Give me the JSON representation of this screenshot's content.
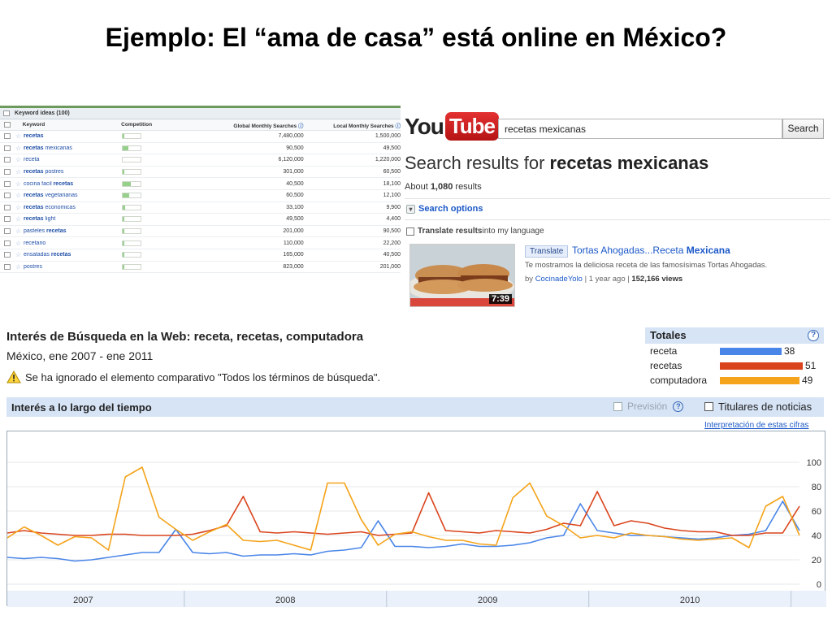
{
  "slide": {
    "title": "Ejemplo: El “ama de casa” está online en México?"
  },
  "keyword_tool": {
    "header": "Keyword ideas (100)",
    "columns": [
      "Keyword",
      "Competition",
      "Global Monthly Searches",
      "Local Monthly Searches"
    ],
    "rows": [
      {
        "pre": "",
        "bold": "recetas",
        "post": "",
        "competition": 0.1,
        "global": "7,480,000",
        "local": "1,500,000"
      },
      {
        "pre": "",
        "bold": "recetas",
        "post": " mexicanas",
        "competition": 0.3,
        "global": "90,500",
        "local": "49,500"
      },
      {
        "pre": "receta",
        "bold": "",
        "post": "",
        "competition": 0.0,
        "global": "6,120,000",
        "local": "1,220,000"
      },
      {
        "pre": "",
        "bold": "recetas",
        "post": " postres",
        "competition": 0.1,
        "global": "301,000",
        "local": "60,500"
      },
      {
        "pre": "cocina facil ",
        "bold": "recetas",
        "post": "",
        "competition": 0.45,
        "global": "40,500",
        "local": "18,100"
      },
      {
        "pre": "",
        "bold": "recetas",
        "post": " vegetarianas",
        "competition": 0.35,
        "global": "60,500",
        "local": "12,100"
      },
      {
        "pre": "",
        "bold": "recetas",
        "post": " economicas",
        "competition": 0.15,
        "global": "33,100",
        "local": "9,900"
      },
      {
        "pre": "",
        "bold": "recetas",
        "post": " light",
        "competition": 0.1,
        "global": "49,500",
        "local": "4,400"
      },
      {
        "pre": "pasteles ",
        "bold": "recetas",
        "post": "",
        "competition": 0.1,
        "global": "201,000",
        "local": "90,500"
      },
      {
        "pre": "recetario",
        "bold": "",
        "post": "",
        "competition": 0.1,
        "global": "110,000",
        "local": "22,200"
      },
      {
        "pre": "ensaladas ",
        "bold": "recetas",
        "post": "",
        "competition": 0.1,
        "global": "165,000",
        "local": "40,500"
      },
      {
        "pre": "postres",
        "bold": "",
        "post": "",
        "competition": 0.1,
        "global": "823,000",
        "local": "201,000"
      }
    ]
  },
  "youtube": {
    "logo_you": "You",
    "logo_tube": "Tube",
    "search_value": "recetas mexicanas",
    "search_button": "Search",
    "results_prefix": "Search results for ",
    "results_query": "recetas mexicanas",
    "about_prefix": "About ",
    "about_count": "1,080",
    "about_suffix": " results",
    "search_options": "Search options",
    "translate_bold": "Translate results",
    "translate_rest": " into my language",
    "translate_button": "Translate",
    "video_title_pre": "Tortas Ahogadas...Receta ",
    "video_title_bold": "Mexicana",
    "video_desc": "Te mostramos la deliciosa receta de las famosísimas Tortas Ahogadas.",
    "video_channel": "CocinadeYolo",
    "video_age": " | 1 year ago | ",
    "video_views": "152,166 views",
    "video_duration": "7:39"
  },
  "trends": {
    "title": "Interés de Búsqueda en la Web: receta, recetas, computadora",
    "subtitle": "México, ene 2007 - ene 2011",
    "warning": "Se ha ignorado el elemento comparativo \"Todos los términos de búsqueda\".",
    "totals_title": "Totales",
    "totals": [
      {
        "label": "receta",
        "value": 38,
        "color": "#4a86e8"
      },
      {
        "label": "recetas",
        "value": 51,
        "color": "#d9441c"
      },
      {
        "label": "computadora",
        "value": 49,
        "color": "#f4a31a"
      }
    ],
    "band_title": "Interés a lo largo del tiempo",
    "forecast_label": "Previsión",
    "news_label": "Titulares de noticias",
    "interpretation_link": "Interpretación de estas cifras"
  },
  "chart_data": {
    "type": "line",
    "x": [
      "2007",
      "2008",
      "2009",
      "2010"
    ],
    "yticks": [
      0,
      20,
      40,
      60,
      80,
      100
    ],
    "ylim": [
      0,
      100
    ],
    "series": [
      {
        "name": "receta",
        "color": "#4a86e8",
        "values": [
          22,
          21,
          22,
          21,
          19,
          20,
          22,
          24,
          26,
          26,
          45,
          26,
          25,
          26,
          23,
          24,
          24,
          25,
          24,
          27,
          28,
          30,
          52,
          31,
          31,
          30,
          31,
          33,
          31,
          31,
          32,
          34,
          38,
          40,
          66,
          44,
          42,
          40,
          40,
          39,
          38,
          37,
          38,
          40,
          41,
          44,
          68,
          44
        ]
      },
      {
        "name": "recetas",
        "color": "#d9441c",
        "values": [
          42,
          44,
          42,
          41,
          40,
          40,
          41,
          41,
          40,
          40,
          40,
          41,
          44,
          48,
          72,
          43,
          42,
          43,
          42,
          41,
          42,
          43,
          40,
          41,
          42,
          75,
          44,
          43,
          42,
          44,
          43,
          42,
          45,
          50,
          48,
          76,
          48,
          52,
          50,
          46,
          44,
          43,
          43,
          40,
          40,
          42,
          42,
          64
        ]
      },
      {
        "name": "computadora",
        "color": "#f4a31a",
        "values": [
          38,
          47,
          40,
          32,
          39,
          38,
          28,
          88,
          96,
          55,
          45,
          36,
          43,
          49,
          36,
          35,
          36,
          32,
          28,
          83,
          83,
          53,
          32,
          41,
          43,
          39,
          36,
          36,
          33,
          32,
          71,
          83,
          56,
          48,
          38,
          40,
          38,
          42,
          40,
          39,
          37,
          36,
          37,
          38,
          30,
          64,
          72,
          40
        ]
      }
    ]
  }
}
